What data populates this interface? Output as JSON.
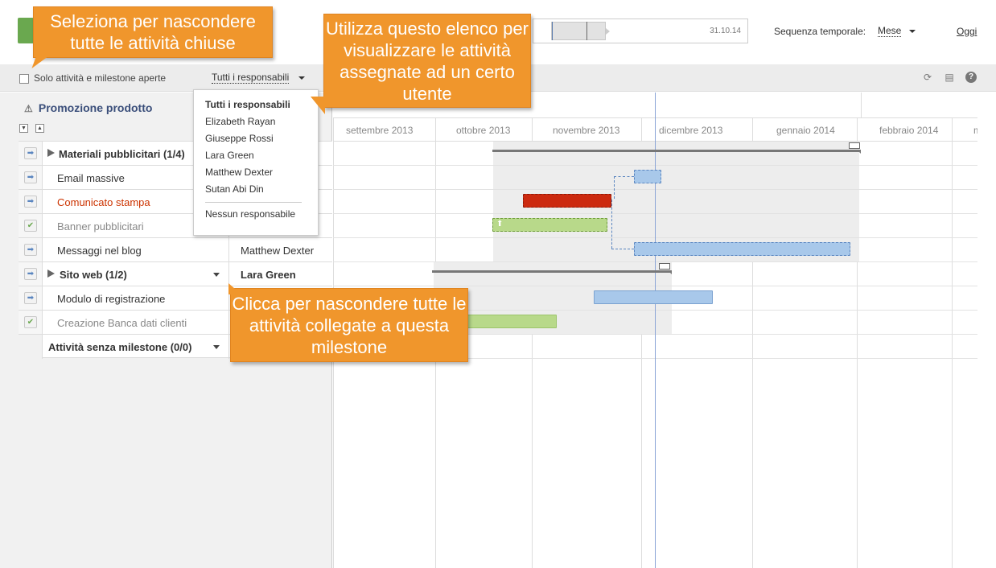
{
  "header": {
    "range_end_date": "31.10.14",
    "timeline_label": "Sequenza temporale:",
    "timeline_value": "Mese",
    "today_link": "Oggi"
  },
  "toolbar": {
    "open_only_label": "Solo attività e milestone aperte",
    "responsible_filter": "Tutti i responsabili",
    "icons": [
      "refresh-icon",
      "print-icon",
      "help-icon"
    ]
  },
  "project": {
    "title": "Promozione prodotto"
  },
  "rows": [
    {
      "name": "Materiali pubblicitari (1/4)",
      "owner": "",
      "type": "milestone"
    },
    {
      "name": "Email massive",
      "owner": "",
      "type": "task"
    },
    {
      "name": "Comunicato stampa",
      "owner": "",
      "type": "task-overdue"
    },
    {
      "name": "Banner pubblicitari",
      "owner": "",
      "type": "task-done"
    },
    {
      "name": "Messaggi nel blog",
      "owner": "Matthew Dexter",
      "type": "task"
    },
    {
      "name": "Sito web (1/2)",
      "owner": "Lara Green",
      "type": "milestone"
    },
    {
      "name": "Modulo di registrazione",
      "owner": "",
      "type": "task"
    },
    {
      "name": "Creazione Banca dati clienti",
      "owner": "",
      "type": "task-done"
    },
    {
      "name": "Attività senza milestone (0/0)",
      "owner": "",
      "type": "group"
    }
  ],
  "months": [
    "settembre 2013",
    "ottobre 2013",
    "novembre 2013",
    "dicembre 2013",
    "gennaio 2014",
    "febbraio 2014",
    "m"
  ],
  "dropdown": {
    "items": [
      "Tutti i responsabili",
      "Elizabeth Rayan",
      "Giuseppe Rossi",
      "Lara Green",
      "Matthew Dexter",
      "Sutan Abi Din"
    ],
    "none_item": "Nessun responsabile"
  },
  "callouts": {
    "hide_closed": "Seleziona per nascondere tutte le attività chiuse",
    "filter_user": "Utilizza questo elenco per visualizzare le attività assegnate ad un certo utente",
    "hide_linked": "Clicca per nascondere tutte le attività collegate a questa milestone"
  },
  "colors": {
    "accent": "#f0962c",
    "task_blue": "#a8c8ea",
    "task_red": "#cc2a10",
    "task_green": "#b8d98a",
    "project_title": "#3a4e7a"
  }
}
